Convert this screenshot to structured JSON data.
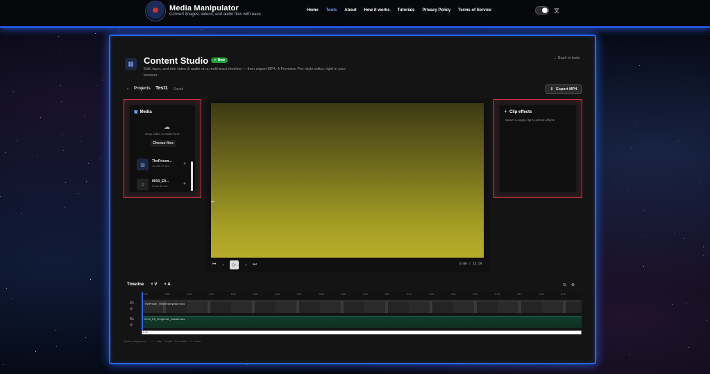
{
  "brand": {
    "title": "Media Manipulator",
    "subtitle": "Convert images, videos, and audio files with ease"
  },
  "nav": [
    {
      "label": "Home",
      "active": false
    },
    {
      "label": "Tools",
      "active": true
    },
    {
      "label": "About",
      "active": false
    },
    {
      "label": "How it works",
      "active": false
    },
    {
      "label": "Tutorials",
      "active": false
    },
    {
      "label": "Privacy Policy",
      "active": false
    },
    {
      "label": "Terms of Service",
      "active": false
    }
  ],
  "studio": {
    "title": "Content Studio",
    "badge": "New",
    "description": "Edit, layer, and mix video & audio on a multi-track timeline — then export MP4. A Premiere Pro–style editor, right in your browser.",
    "back_label": "Back to tools"
  },
  "project": {
    "projects_label": "Projects",
    "name": "Test1",
    "status": "· Saved",
    "export_label": "Export MP4"
  },
  "media": {
    "title": "Media",
    "drop_text": "Drop video or audio here",
    "choose_label": "Choose files",
    "items": [
      {
        "name": "ThePrison...",
        "meta": "16 min 57 sec",
        "icon": "film-icon"
      },
      {
        "name": "0010_E9...",
        "meta": "5 min 42 sec",
        "icon": "music-icon"
      }
    ]
  },
  "effects": {
    "title": "Clip effects",
    "hint": "Select a single clip to edit its effects."
  },
  "player": {
    "time": "0:00 / 15:59"
  },
  "timeline": {
    "title": "Timeline",
    "add_video": "+ V",
    "add_audio": "+ A",
    "ticks": [
      "0:00",
      "0:01",
      "0:02",
      "0:03",
      "0:04",
      "0:05",
      "0:06",
      "0:07",
      "0:08",
      "0:09",
      "0:10",
      "0:11",
      "0:12",
      "0:13",
      "0:14",
      "0:15",
      "0:16",
      "0:17",
      "0:18",
      "0:19"
    ],
    "tracks": [
      {
        "label": "V1",
        "clip": "ThePrison_TheDreamyMan.mp4"
      },
      {
        "label": "A1",
        "clip": "0010_E9_Drugerole_Sanshi.wav"
      }
    ],
    "bar_label": "0:00",
    "shortcuts": "Space play/pause · ← / → step · S split · Del delete · +/− zoom"
  },
  "colors": {
    "accent": "#2a66ff",
    "card_border": "#d9334a",
    "badge": "#1f9d3a",
    "preview_top": "#3d3a14",
    "preview_bottom": "#b6ad2a"
  }
}
